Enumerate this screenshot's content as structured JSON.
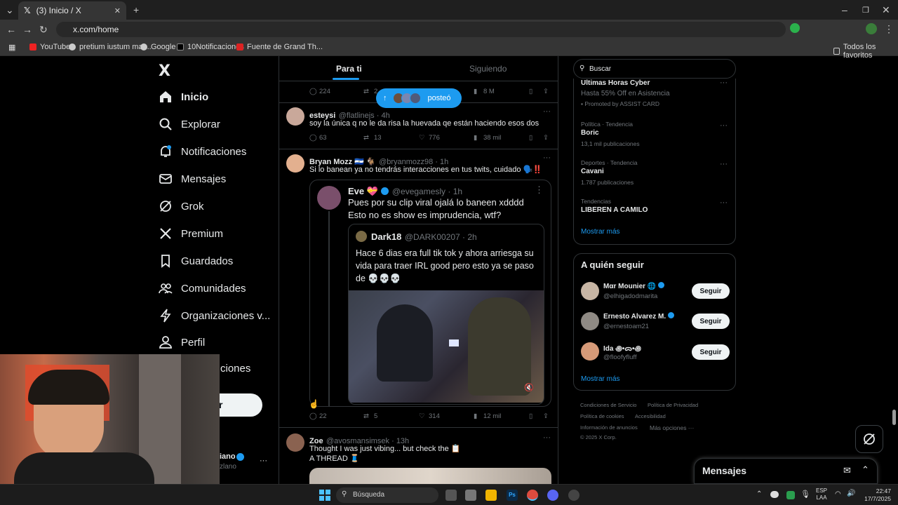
{
  "browser": {
    "tab_title": "(3) Inicio / X",
    "tab_close": "✕",
    "new_tab": "+",
    "url": "x.com/home",
    "bookmarks": [
      "YouTube",
      "pretium iustum mat...",
      "Google",
      "10Notificaciones",
      "Fuente de Grand Th..."
    ],
    "all_bookmarks": "Todos los favoritos"
  },
  "nav": {
    "logo": "X",
    "items": [
      "Inicio",
      "Explorar",
      "Notificaciones",
      "Mensajes",
      "Grok",
      "Premium",
      "Guardados",
      "Comunidades",
      "Organizaciones v...",
      "Perfil",
      "ciones"
    ],
    "post_button": "r",
    "account_name": "iano",
    "account_handle": "zlano",
    "account_more": "···"
  },
  "feed": {
    "tabs": [
      "Para ti",
      "Siguiendo"
    ],
    "new_posts_pill": "posteó",
    "top_actions": {
      "replies": "224",
      "reposts": "2",
      "views": "8 M"
    },
    "posts": [
      {
        "name": "esteysi",
        "handle": "@flatlinejs · 4h",
        "text": "soy la única q no le da risa la huevada qe están haciendo esos dos",
        "replies": "63",
        "reposts": "13",
        "likes": "776",
        "views": "38 mil"
      },
      {
        "name": "Bryan Mozz 🇸🇻 🐐",
        "handle": "@bryanmozz98 · 1h",
        "text": "Si lo banean ya no tendrás interacciones en tus twits, cuidado 🗣️‼️",
        "replies": "22",
        "reposts": "5",
        "likes": "314",
        "views": "12 mil",
        "quote": {
          "name": "Eve 💝",
          "handle": "@evegamesly · 1h",
          "text": "Pues por su clip viral ojalá lo baneen xdddd Esto no es show es imprudencia, wtf?",
          "inner": {
            "name": "Dark18",
            "handle": "@DARK00207 · 2h",
            "text": "Hace 6 dias era full tik tok y ahora arriesga su vida para traer IRL good pero esto ya se paso de 💀💀💀"
          }
        }
      },
      {
        "name": "Zoe",
        "handle": "@avosmansimsek · 13h",
        "text1": "Thought I was just vibing... but check the 📋",
        "text2": "A THREAD 🧵"
      }
    ]
  },
  "right": {
    "search_placeholder": "Buscar",
    "ad": {
      "title": "Ultimas Horas Cyber",
      "subtitle": "Hasta 55% Off en Asistencia",
      "promoted": "Promoted by ASSIST CARD"
    },
    "trends": [
      {
        "meta": "Política · Tendencia",
        "name": "Boric",
        "count": "13,1 mil publicaciones"
      },
      {
        "meta": "Deportes · Tendencia",
        "name": "Cavani",
        "count": "1.787 publicaciones"
      },
      {
        "meta": "Tendencias",
        "name": "LIBEREN A CAMILO",
        "count": ""
      }
    ],
    "show_more": "Mostrar más",
    "who_to_follow": "A quién seguir",
    "follows": [
      {
        "name": "Mαr Mounier 🌐",
        "handle": "@elhigadodmarita"
      },
      {
        "name": "Ernesto Alvarez M.",
        "handle": "@ernestoam21"
      },
      {
        "name": "Ida ꩜•ᯅ•꩜",
        "handle": "@floofyfluff"
      }
    ],
    "follow_label": "Seguir",
    "footer": [
      "Condiciones de Servicio",
      "Política de Privacidad",
      "Política de cookies",
      "Accesibilidad",
      "Información de anuncios",
      "Más opciones ···",
      "© 2025 X Corp."
    ],
    "messages": "Mensajes"
  },
  "taskbar": {
    "search": "Búsqueda",
    "lang1": "ESP",
    "lang2": "LAA",
    "time": "22:47",
    "date": "17/7/2025"
  },
  "colors": {
    "accent": "#1d9bf0",
    "bg": "#000000",
    "border": "#2f3336",
    "muted": "#71767b"
  }
}
